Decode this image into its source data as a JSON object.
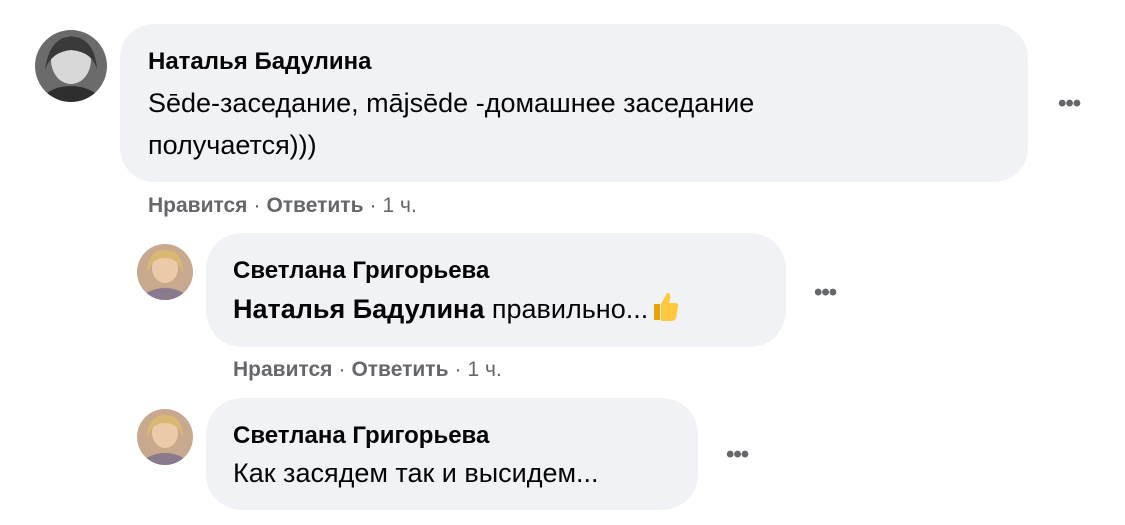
{
  "comments": [
    {
      "author": "Наталья Бадулина",
      "text_line1": "Sēde-заседание, mājsēde -домашнее заседание",
      "text_line2": "получается)))",
      "actions": {
        "like": "Нравится",
        "reply": "Ответить",
        "time": "1 ч."
      },
      "more": "•••"
    },
    {
      "author": "Светлана Григорьева",
      "mention": "Наталья Бадулина",
      "text": " правильно...",
      "emoji": "thumbs-up",
      "actions": {
        "like": "Нравится",
        "reply": "Ответить",
        "time": "1 ч."
      },
      "more": "•••"
    },
    {
      "author": "Светлана Григорьева",
      "text": "Как засядем так и высидем...",
      "more": "•••"
    }
  ],
  "colors": {
    "bubble": "#f0f2f5",
    "meta": "#65676b",
    "text": "#050505"
  }
}
